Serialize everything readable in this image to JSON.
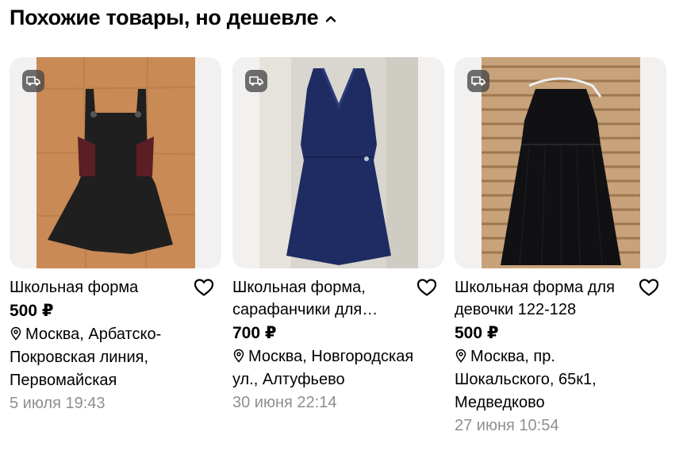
{
  "section": {
    "title": "Похожие товары, но дешевле"
  },
  "items": [
    {
      "title": "Школьная форма",
      "price": "500 ₽",
      "location": "Москва, Арбатско-Покровская линия, Первомайская",
      "date": "5 июля 19:43"
    },
    {
      "title": "Школьная форма, сарафанчики для девочки",
      "price": "700 ₽",
      "location": "Москва, Новгородская ул., Алтуфьево",
      "date": "30 июня 22:14"
    },
    {
      "title": "Школьная форма для девочки 122-128",
      "price": "500 ₽",
      "location": "Москва, пр. Шокальского, 65к1, Медведково",
      "date": "27 июня 10:54"
    }
  ],
  "icons": {
    "section_toggle": "chevron-up-icon",
    "delivery": "truck-icon",
    "favorite": "heart-icon",
    "location": "location-pin-icon"
  },
  "colors": {
    "text": "#000000",
    "muted": "#8f8f8f",
    "photo_bg": "#f2f1f0",
    "badge_bg": "#4a4a4a"
  }
}
